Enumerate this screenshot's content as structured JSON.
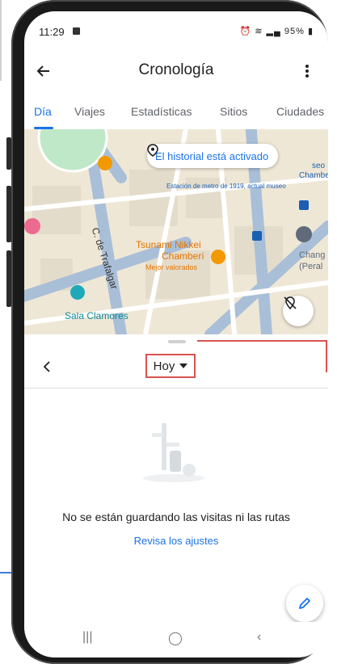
{
  "status_bar": {
    "time": "11:29",
    "battery": "95%"
  },
  "app_bar": {
    "title": "Cronología"
  },
  "tabs": [
    {
      "label": "Día",
      "active": true
    },
    {
      "label": "Viajes",
      "active": false
    },
    {
      "label": "Estadísticas",
      "active": false
    },
    {
      "label": "Sitios",
      "active": false
    },
    {
      "label": "Ciudades",
      "active": false
    }
  ],
  "map": {
    "history_chip": "El historial está activado",
    "labels": {
      "street": "C. de Trafalgar",
      "restaurant": "Tsunami Nikkei",
      "restaurant_line2": "Chamberí",
      "restaurant_sub": "Mejor valorados",
      "venue": "Sala Clamores",
      "metro_partial": "Estación de metro de 1919, actual museo",
      "museum_partial": "Chamberí",
      "museum_partial2": "seo",
      "right_partial": "Chang",
      "right_partial2": "(Peral"
    }
  },
  "date_nav": {
    "date_label": "Hoy"
  },
  "empty_state": {
    "message": "No se están guardando las visitas ni las rutas",
    "link": "Revisa los ajustes"
  },
  "colors": {
    "accent": "#1a73e8",
    "callout": "#d9534f"
  }
}
